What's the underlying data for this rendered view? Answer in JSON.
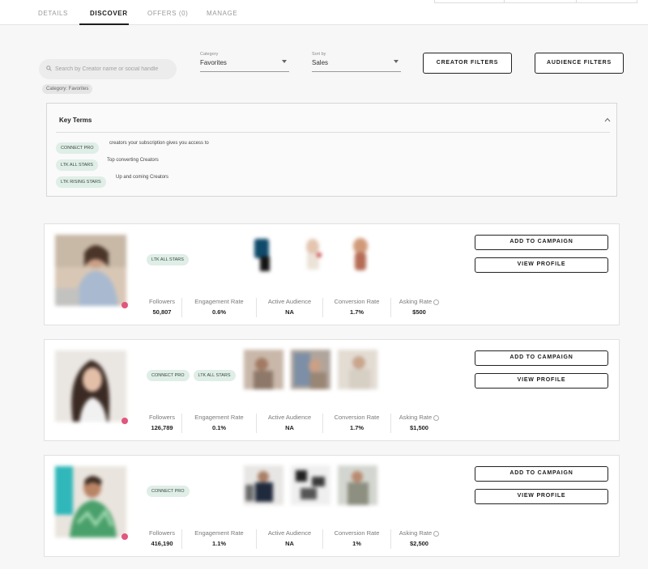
{
  "tabs": [
    {
      "label": "DETAILS"
    },
    {
      "label": "DISCOVER"
    },
    {
      "label": "OFFERS (0)"
    },
    {
      "label": "MANAGE"
    }
  ],
  "search": {
    "placeholder": "Search by Creator name or social handle"
  },
  "active_filter_chip": "Category: Favorites",
  "category_select": {
    "label": "Category",
    "value": "Favorites"
  },
  "sort_select": {
    "label": "Sort by",
    "value": "Sales"
  },
  "buttons": {
    "creator_filters": "CREATOR FILTERS",
    "audience_filters": "AUDIENCE FILTERS"
  },
  "key_terms": {
    "title": "Key Terms",
    "terms": [
      {
        "badge": "CONNECT PRO",
        "desc": "creators your subscription gives you access to"
      },
      {
        "badge": "LTK ALL STARS",
        "desc": "Top converting Creators"
      },
      {
        "badge": "LTK RISING STARS",
        "desc": "Up and coming Creators"
      }
    ]
  },
  "card_actions": {
    "add": "ADD TO CAMPAIGN",
    "view": "VIEW PROFILE"
  },
  "stat_labels": {
    "followers": "Followers",
    "engagement": "Engagement Rate",
    "audience": "Active Audience",
    "conversion": "Conversion Rate",
    "asking": "Asking Rate"
  },
  "creators": [
    {
      "badges": [
        "LTK ALL STARS"
      ],
      "followers": "50,807",
      "engagement": "0.6%",
      "audience": "NA",
      "conversion": "1.7%",
      "asking": "$500"
    },
    {
      "badges": [
        "CONNECT PRO",
        "LTK ALL STARS"
      ],
      "followers": "126,789",
      "engagement": "0.1%",
      "audience": "NA",
      "conversion": "1.7%",
      "asking": "$1,500"
    },
    {
      "badges": [
        "CONNECT PRO"
      ],
      "followers": "416,190",
      "engagement": "1.1%",
      "audience": "NA",
      "conversion": "1%",
      "asking": "$2,500"
    }
  ],
  "colors": {
    "badge_bg": "#dfeee7",
    "heart": "#e0567e",
    "accent": "#1d1d1d"
  },
  "icons": {
    "search": "search-icon",
    "collapse": "chevron-up-icon",
    "favorite": "heart-icon",
    "info": "info-icon"
  }
}
